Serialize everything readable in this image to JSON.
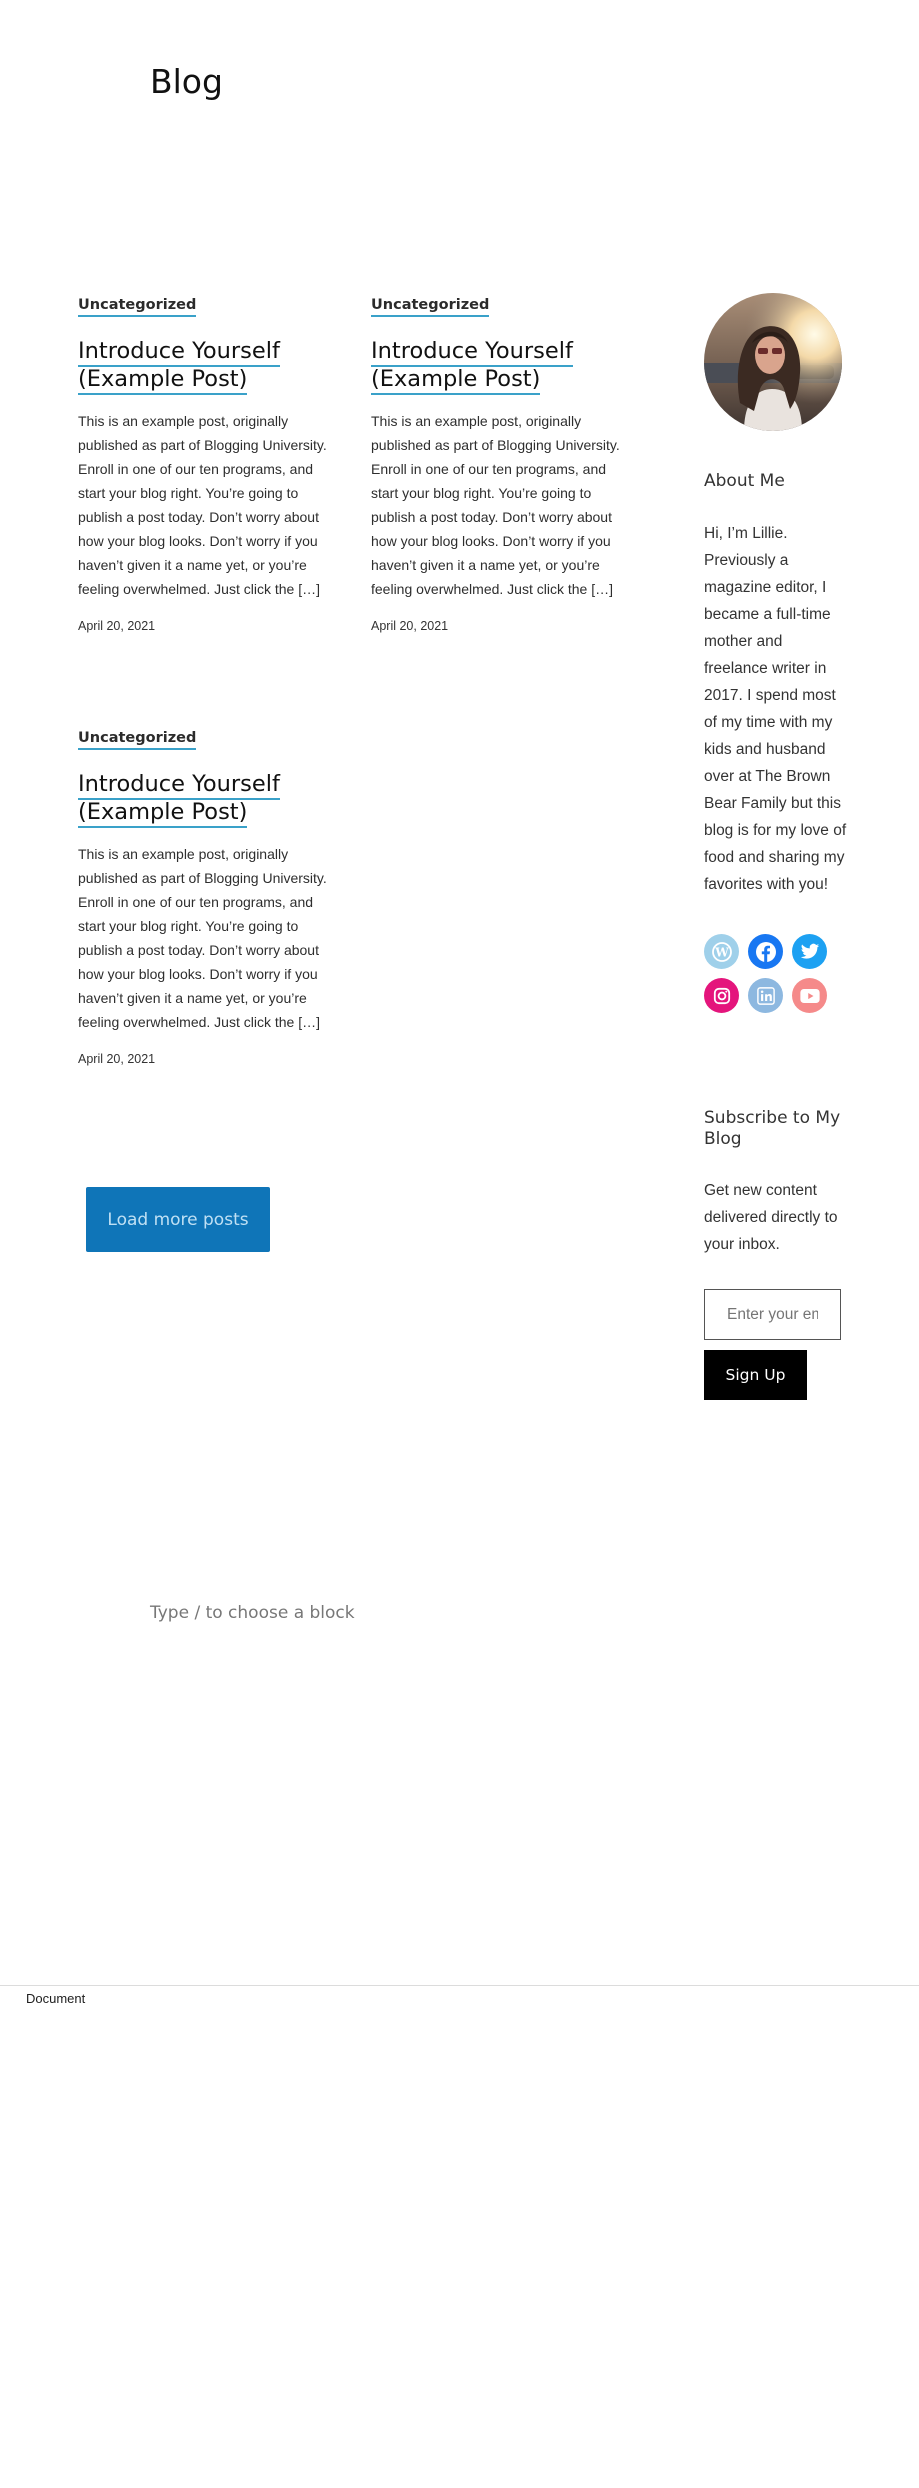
{
  "page": {
    "title": "Blog"
  },
  "posts": [
    {
      "category": "Uncategorized",
      "title": "Introduce Yourself (Example Post)",
      "excerpt": "This is an example post, originally published as part of Blogging University. Enroll in one of our ten programs, and start your blog right. You’re going to publish a post today. Don’t worry about how your blog looks. Don’t worry if you haven’t given it a name yet, or you’re feeling overwhelmed. Just click the […]",
      "date": "April 20, 2021"
    },
    {
      "category": "Uncategorized",
      "title": "Introduce Yourself (Example Post)",
      "excerpt": "This is an example post, originally published as part of Blogging University. Enroll in one of our ten programs, and start your blog right. You’re going to publish a post today. Don’t worry about how your blog looks. Don’t worry if you haven’t given it a name yet, or you’re feeling overwhelmed. Just click the […]",
      "date": "April 20, 2021"
    },
    {
      "category": "Uncategorized",
      "title": "Introduce Yourself (Example Post)",
      "excerpt": "This is an example post, originally published as part of Blogging University. Enroll in one of our ten programs, and start your blog right. You’re going to publish a post today. Don’t worry about how your blog looks. Don’t worry if you haven’t given it a name yet, or you’re feeling overwhelmed. Just click the […]",
      "date": "April 20, 2021"
    }
  ],
  "load_more": {
    "label": "Load more posts"
  },
  "sidebar": {
    "about_heading": "About Me",
    "about_text": "Hi, I’m Lillie. Previously a magazine editor, I became a full-time mother and freelance writer in 2017. I spend most of my time with my kids and husband over at The Brown Bear Family but this blog is for my love of food and sharing my favorites with you!",
    "socials": [
      {
        "icon": "wordpress-icon",
        "color": "#9fd0ea"
      },
      {
        "icon": "facebook-icon",
        "color": "#1877f2"
      },
      {
        "icon": "twitter-icon",
        "color": "#1da1f2"
      },
      {
        "icon": "instagram-icon",
        "color": "#e4157c"
      },
      {
        "icon": "linkedin-icon",
        "color": "#8db8e0"
      },
      {
        "icon": "youtube-icon",
        "color": "#f58a8a"
      }
    ],
    "subscribe_heading": "Subscribe to My Blog",
    "subscribe_text": "Get new content delivered directly to your inbox.",
    "email_placeholder": "Enter your email address",
    "signup_label": "Sign Up"
  },
  "editor": {
    "block_prompt": "Type / to choose a block"
  },
  "footer": {
    "label": "Document"
  }
}
